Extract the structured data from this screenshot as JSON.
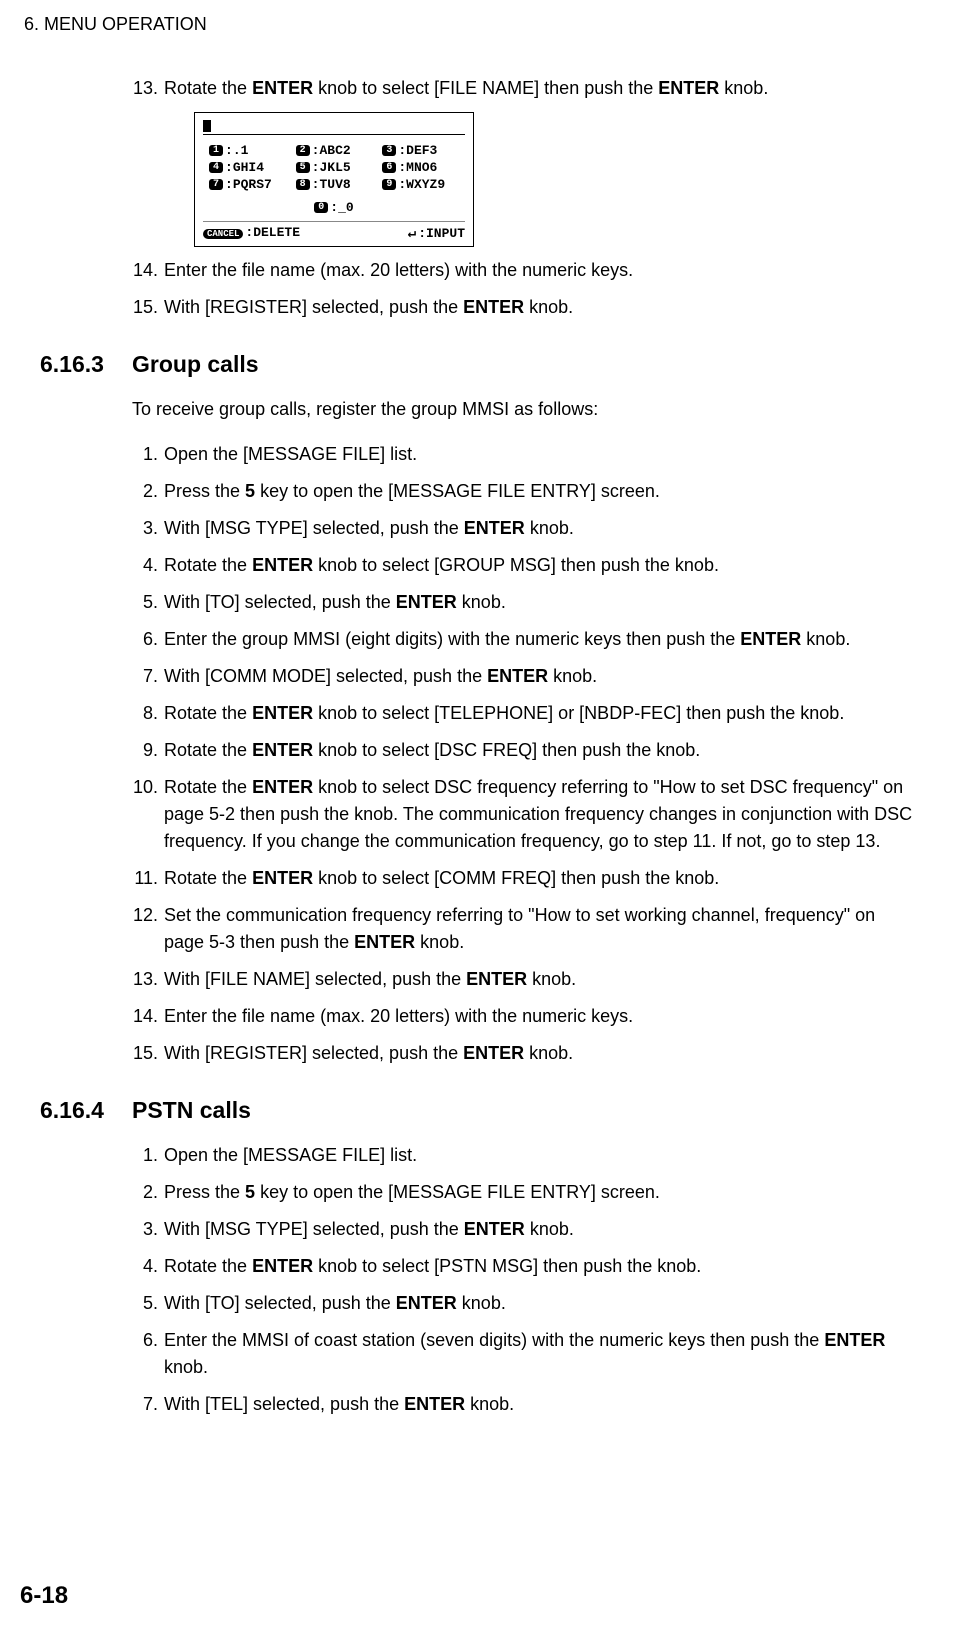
{
  "header": "6.  MENU OPERATION",
  "page_number": "6-18",
  "top_steps": {
    "s13": {
      "num": "13.",
      "pre": "Rotate the ",
      "b1": "ENTER",
      "mid": " knob to select [FILE NAME] then push the ",
      "b2": "ENTER",
      "post": " knob."
    },
    "s14": {
      "num": "14.",
      "text": "Enter the file name (max. 20 letters) with the numeric keys."
    },
    "s15": {
      "num": "15.",
      "pre": "With [REGISTER] selected, push the ",
      "b1": "ENTER",
      "post": " knob."
    }
  },
  "figure": {
    "keys": {
      "k1": {
        "n": "1",
        "t": ":.1"
      },
      "k2": {
        "n": "2",
        "t": ":ABC2"
      },
      "k3": {
        "n": "3",
        "t": ":DEF3"
      },
      "k4": {
        "n": "4",
        "t": ":GHI4"
      },
      "k5": {
        "n": "5",
        "t": ":JKL5"
      },
      "k6": {
        "n": "6",
        "t": ":MNO6"
      },
      "k7": {
        "n": "7",
        "t": ":PQRS7"
      },
      "k8": {
        "n": "8",
        "t": ":TUV8"
      },
      "k9": {
        "n": "9",
        "t": ":WXYZ9"
      },
      "k0": {
        "n": "0",
        "t": ":_0"
      }
    },
    "cancel_label": "CANCEL",
    "delete_label": ":DELETE",
    "input_label": ":INPUT"
  },
  "sec3": {
    "num": "6.16.3",
    "title": "Group calls",
    "intro": "To receive group calls, register the group MMSI as follows:",
    "s1": {
      "num": "1.",
      "text": "Open the [MESSAGE FILE] list."
    },
    "s2": {
      "num": "2.",
      "pre": "Press the ",
      "b1": "5",
      "post": " key to open the [MESSAGE FILE ENTRY] screen."
    },
    "s3": {
      "num": "3.",
      "pre": "With [MSG TYPE] selected, push the ",
      "b1": "ENTER",
      "post": " knob."
    },
    "s4": {
      "num": "4.",
      "pre": "Rotate the ",
      "b1": "ENTER",
      "post": " knob to select [GROUP MSG] then push the knob."
    },
    "s5": {
      "num": "5.",
      "pre": "With [TO] selected, push the ",
      "b1": "ENTER",
      "post": " knob."
    },
    "s6": {
      "num": "6.",
      "pre": "Enter the group MMSI (eight digits) with the numeric keys then push the ",
      "b1": "ENTER",
      "post": " knob."
    },
    "s7": {
      "num": "7.",
      "pre": "With [COMM MODE] selected, push the ",
      "b1": "ENTER",
      "post": " knob."
    },
    "s8": {
      "num": "8.",
      "pre": "Rotate the ",
      "b1": "ENTER",
      "post": " knob to select [TELEPHONE] or [NBDP-FEC] then push the knob."
    },
    "s9": {
      "num": "9.",
      "pre": "Rotate the ",
      "b1": "ENTER",
      "post": " knob to select [DSC FREQ] then push the knob."
    },
    "s10": {
      "num": "10.",
      "pre": "Rotate the ",
      "b1": "ENTER",
      "post": " knob to select DSC frequency referring to \"How to set DSC frequency\" on page 5-2 then push the knob. The communication frequency changes in conjunction with DSC frequency. If you change the communication frequency, go to step 11. If not, go to step 13."
    },
    "s11": {
      "num": "11.",
      "pre": "Rotate the ",
      "b1": "ENTER",
      "post": " knob to select  [COMM FREQ] then push the knob."
    },
    "s12": {
      "num": "12.",
      "pre": "Set the communication frequency referring to \"How to set working channel, frequency\" on page 5-3 then push the ",
      "b1": "ENTER",
      "post": " knob."
    },
    "s13": {
      "num": "13.",
      "pre": "With [FILE NAME] selected, push the ",
      "b1": "ENTER",
      "post": " knob."
    },
    "s14": {
      "num": "14.",
      "text": "Enter the file name (max. 20 letters) with the numeric keys."
    },
    "s15": {
      "num": "15.",
      "pre": "With [REGISTER] selected, push the ",
      "b1": "ENTER",
      "post": " knob."
    }
  },
  "sec4": {
    "num": "6.16.4",
    "title": "PSTN calls",
    "s1": {
      "num": "1.",
      "text": "Open the [MESSAGE FILE] list."
    },
    "s2": {
      "num": "2.",
      "pre": "Press the ",
      "b1": "5",
      "post": " key to open the [MESSAGE FILE ENTRY] screen."
    },
    "s3": {
      "num": "3.",
      "pre": "With [MSG TYPE] selected, push the ",
      "b1": "ENTER",
      "post": " knob."
    },
    "s4": {
      "num": "4.",
      "pre": "Rotate the ",
      "b1": "ENTER",
      "post": " knob to select [PSTN MSG] then push the knob."
    },
    "s5": {
      "num": "5.",
      "pre": "With [TO] selected, push the ",
      "b1": "ENTER",
      "post": " knob."
    },
    "s6": {
      "num": "6.",
      "pre": "Enter the MMSI of coast station (seven digits) with the numeric keys then push the ",
      "b1": "ENTER",
      "post": " knob."
    },
    "s7": {
      "num": "7.",
      "pre": "With [TEL] selected, push the ",
      "b1": "ENTER",
      "post": " knob."
    }
  }
}
